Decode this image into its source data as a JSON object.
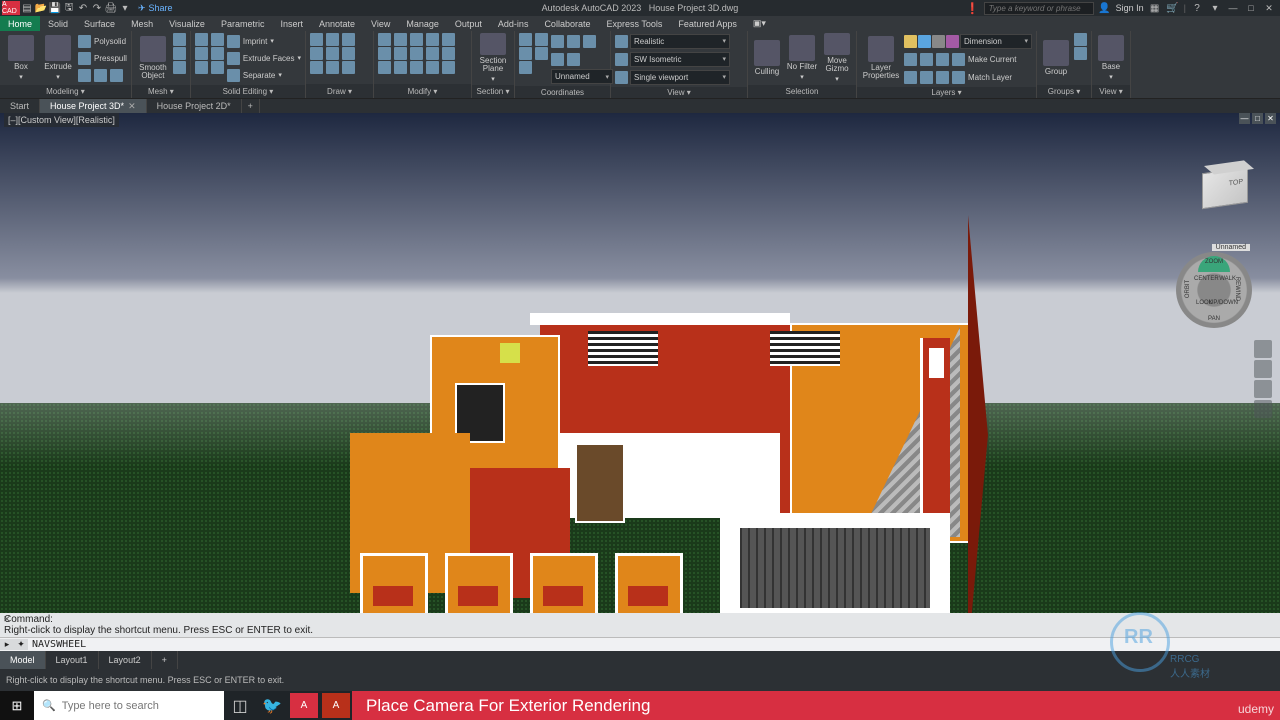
{
  "title_bar": {
    "app_badge": "A CAD",
    "center_app": "Autodesk AutoCAD 2023",
    "center_file": "House Project 3D.dwg",
    "share": "Share",
    "search_placeholder": "Type a keyword or phrase",
    "signin": "Sign In",
    "win_min": "—",
    "win_max": "□",
    "win_close": "✕"
  },
  "menu": {
    "tabs": [
      "Home",
      "Solid",
      "Surface",
      "Mesh",
      "Visualize",
      "Parametric",
      "Insert",
      "Annotate",
      "View",
      "Manage",
      "Output",
      "Add-ins",
      "Collaborate",
      "Express Tools",
      "Featured Apps"
    ]
  },
  "ribbon": {
    "modeling": {
      "title": "Modeling ▾",
      "box": "Box",
      "extrude": "Extrude",
      "polysolid": "Polysolid",
      "presspull": "Presspull"
    },
    "mesh": {
      "title": "Mesh ▾",
      "smooth": "Smooth\nObject"
    },
    "solid_editing": {
      "title": "Solid Editing ▾",
      "imprint": "Imprint",
      "extrude_faces": "Extrude Faces",
      "separate": "Separate"
    },
    "draw": {
      "title": "Draw ▾"
    },
    "modify": {
      "title": "Modify ▾"
    },
    "section": {
      "title": "Section ▾",
      "plane": "Section\nPlane"
    },
    "coordinates": {
      "title": "Coordinates",
      "unnamed": "Unnamed"
    },
    "view": {
      "title": "View ▾",
      "visual": "Realistic",
      "iso": "SW Isometric",
      "viewport": "Single viewport"
    },
    "selection": {
      "title": "Selection",
      "culling": "Culling",
      "nofilter": "No Filter",
      "gizmo": "Move\nGizmo"
    },
    "layers": {
      "title": "Layers ▾",
      "props": "Layer\nProperties",
      "dim_layer": "Dimension",
      "make_current": "Make Current",
      "match": "Match Layer"
    },
    "groups": {
      "title": "Groups ▾",
      "group": "Group"
    },
    "viewr": {
      "title": "View ▾",
      "base": "Base"
    }
  },
  "file_tabs": {
    "start": "Start",
    "tab1": "House Project 3D*",
    "tab2": "House Project 2D*",
    "add": "+"
  },
  "viewport": {
    "label": "[–][Custom View][Realistic]",
    "cube_top": "TOP",
    "nav_title": "Unnamed",
    "nav_zoom": "ZOOM",
    "nav_pan": "PAN",
    "nav_orbit": "ORBIT",
    "nav_rewind": "REWIND",
    "nav_center": "CENTER",
    "nav_walk": "WALK",
    "nav_look": "LOOK",
    "nav_updown": "UP/DOWN"
  },
  "cmd": {
    "line1": "Command:",
    "line2": "Right-click to display the shortcut menu. Press ESC or ENTER to exit.",
    "input_chev": "▸",
    "input_icon": "✦",
    "input_value": "NAVSWHEEL"
  },
  "layout": {
    "model": "Model",
    "l1": "Layout1",
    "l2": "Layout2",
    "add": "+"
  },
  "status": {
    "hint": "Right-click to display the shortcut menu. Press ESC or ENTER to exit."
  },
  "taskbar": {
    "search_placeholder": "Type here to search",
    "tutorial": "Place Camera For Exterior Rendering",
    "udemy": "udemy"
  },
  "watermark": {
    "rr": "RR",
    "brand": "RRCG",
    "sub": "人人素材"
  }
}
